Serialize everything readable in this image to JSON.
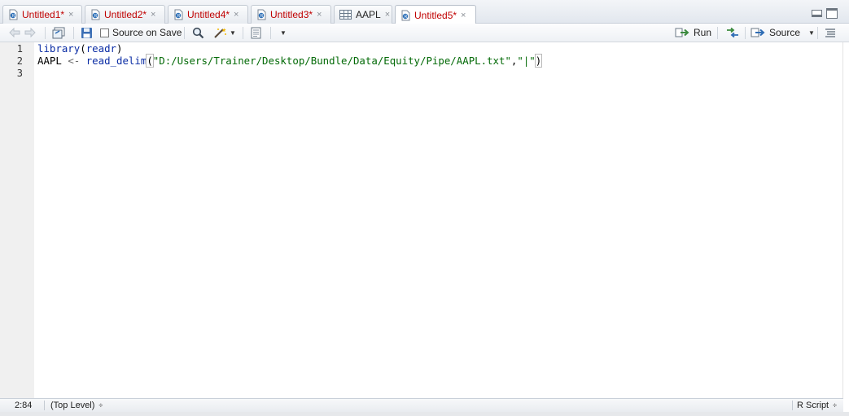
{
  "tabs": [
    {
      "label": "Untitled1*",
      "close": "×"
    },
    {
      "label": "Untitled2*",
      "close": "×"
    },
    {
      "label": "Untitled4*",
      "close": "×"
    },
    {
      "label": "Untitled3*",
      "close": "×"
    },
    {
      "label": "AAPL",
      "close": "×"
    },
    {
      "label": "Untitled5*",
      "close": "×"
    }
  ],
  "toolbar": {
    "source_on_save": "Source on Save",
    "run": "Run",
    "source": "Source"
  },
  "editor": {
    "line_numbers": [
      "1",
      "2",
      "3"
    ],
    "line1": {
      "fn": "library",
      "open": "(",
      "arg": "readr",
      "close": ")"
    },
    "line2": {
      "var": "AAPL",
      "assign": "<-",
      "fn": "read_delim",
      "open": "(",
      "path": "\"D:/Users/Trainer/Desktop/Bundle/Data/Equity/Pipe/AAPL.txt\"",
      "comma": ",",
      "delim": "\"|\"",
      "close": ")"
    }
  },
  "statusbar": {
    "position": "2:84",
    "scope": "(Top Level)",
    "scope_caret": "÷",
    "file_type": "R Script",
    "file_type_caret": "÷"
  },
  "colors": {
    "modified_tab_text": "#c00000",
    "function": "#0b2da5",
    "string": "#036a07",
    "run_arrow": "#3b8a3e"
  }
}
